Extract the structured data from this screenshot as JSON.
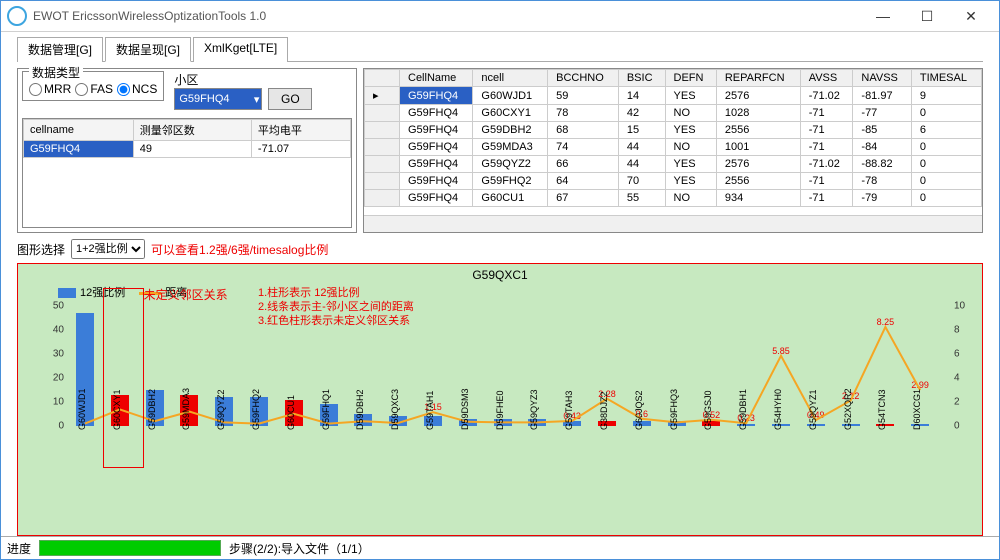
{
  "window": {
    "title": "EWOT EricssonWirelessOptizationTools 1.0"
  },
  "tabs": {
    "t0": "数据管理[G]",
    "t1": "数据呈现[G]",
    "t2": "XmlKget[LTE]",
    "active": 1
  },
  "panel": {
    "fieldset": "数据类型",
    "radios": {
      "mrr": "MRR",
      "fas": "FAS",
      "ncs": "NCS"
    },
    "cell_label": "小区",
    "cell_value": "G59FHQ4",
    "go": "GO",
    "mini_headers": {
      "c0": "cellname",
      "c1": "测量邻区数",
      "c2": "平均电平"
    },
    "mini_row": {
      "c0": "G59FHQ4",
      "c1": "49",
      "c2": "-71.07"
    }
  },
  "grid": {
    "headers": {
      "h0": "CellName",
      "h1": "ncell",
      "h2": "BCCHNO",
      "h3": "BSIC",
      "h4": "DEFN",
      "h5": "REPARFCN",
      "h6": "AVSS",
      "h7": "NAVSS",
      "h8": "TIMESAL"
    },
    "rows": [
      {
        "c0": "G59FHQ4",
        "c1": "G60WJD1",
        "c2": "59",
        "c3": "14",
        "c4": "YES",
        "c5": "2576",
        "c6": "-71.02",
        "c7": "-81.97",
        "c8": "9"
      },
      {
        "c0": "G59FHQ4",
        "c1": "G60CXY1",
        "c2": "78",
        "c3": "42",
        "c4": "NO",
        "c5": "1028",
        "c6": "-71",
        "c7": "-77",
        "c8": "0"
      },
      {
        "c0": "G59FHQ4",
        "c1": "G59DBH2",
        "c2": "68",
        "c3": "15",
        "c4": "YES",
        "c5": "2556",
        "c6": "-71",
        "c7": "-85",
        "c8": "6"
      },
      {
        "c0": "G59FHQ4",
        "c1": "G59MDA3",
        "c2": "74",
        "c3": "44",
        "c4": "NO",
        "c5": "1001",
        "c6": "-71",
        "c7": "-84",
        "c8": "0"
      },
      {
        "c0": "G59FHQ4",
        "c1": "G59QYZ2",
        "c2": "66",
        "c3": "44",
        "c4": "YES",
        "c5": "2576",
        "c6": "-71.02",
        "c7": "-88.82",
        "c8": "0"
      },
      {
        "c0": "G59FHQ4",
        "c1": "G59FHQ2",
        "c2": "64",
        "c3": "70",
        "c4": "YES",
        "c5": "2556",
        "c6": "-71",
        "c7": "-78",
        "c8": "0"
      },
      {
        "c0": "G59FHQ4",
        "c1": "G60CU1",
        "c2": "67",
        "c3": "55",
        "c4": "NO",
        "c5": "934",
        "c6": "-71",
        "c7": "-79",
        "c8": "0"
      }
    ]
  },
  "selector": {
    "label": "图形选择",
    "value": "1+2强比例",
    "hint": "可以查看1.2强/6强/timesalog比例"
  },
  "chart_data": {
    "type": "bar",
    "title": "G59QXC1",
    "legend": {
      "bar": "12强比例",
      "line": "距离"
    },
    "notes": {
      "n1": "1.柱形表示 12强比例",
      "n2": "2.线条表示主-邻小区之间的距离",
      "n3": "3.红色柱形表示未定义邻区关系",
      "anno": "未定义邻区关系"
    },
    "ylabel_left": "",
    "ylim_left": [
      0,
      50
    ],
    "yticks_left": [
      0,
      10,
      20,
      30,
      40,
      50
    ],
    "ylabel_right": "",
    "ylim_right": [
      0,
      10
    ],
    "yticks_right": [
      0,
      2,
      4,
      6,
      8,
      10
    ],
    "categories": [
      "G60WJD1",
      "G60CXY1",
      "G59DBH2",
      "G59MDA3",
      "G59QYZ2",
      "G59FHQ2",
      "G60CU1",
      "G59FHQ1",
      "D59DBH2",
      "D59QXC3",
      "G59TAH1",
      "D59DSM3",
      "D59FHE0",
      "G59QYZ3",
      "G59TAH3",
      "G38DJZ2",
      "G60JQS2",
      "G59FHQ3",
      "G59GSJ0",
      "G59DBH1",
      "G54HYH0",
      "G59QYZ1",
      "G52XQR2",
      "G54TCN3",
      "D60XCG1"
    ],
    "series": [
      {
        "name": "12强比例",
        "type": "bar",
        "values": [
          47,
          13,
          15,
          13,
          12,
          12,
          11,
          9,
          5,
          4,
          4,
          3,
          3,
          3,
          2,
          2,
          2,
          2,
          2,
          1,
          1,
          1,
          1,
          1,
          1
        ],
        "undefined_flags": [
          false,
          true,
          false,
          true,
          false,
          false,
          true,
          false,
          false,
          false,
          false,
          false,
          false,
          false,
          false,
          true,
          false,
          false,
          true,
          false,
          false,
          false,
          false,
          true,
          false
        ]
      },
      {
        "name": "距离",
        "type": "line",
        "values": [
          0.2,
          1.38,
          0.4,
          1.2,
          0.3,
          0.2,
          1.02,
          0.2,
          0.4,
          0.25,
          1.15,
          0.35,
          0.3,
          0.3,
          0.43,
          2.28,
          0.6,
          0.3,
          0.52,
          0.23,
          5.85,
          0.49,
          2.12,
          8.25,
          2.99
        ]
      }
    ],
    "bar_value_labels": {
      "1": "1.38",
      "3": "1.2",
      "6": "1.02",
      "10": "1.15",
      "14": "0.43",
      "15": "2.28",
      "16": "0.6",
      "18": "0.52",
      "19": "0.23",
      "20": "5.85",
      "21": "0.49",
      "22": "2.12",
      "23": "8.25",
      "24": "2.99"
    }
  },
  "status": {
    "label": "进度",
    "step": "步骤(2/2):导入文件（1/1）"
  }
}
